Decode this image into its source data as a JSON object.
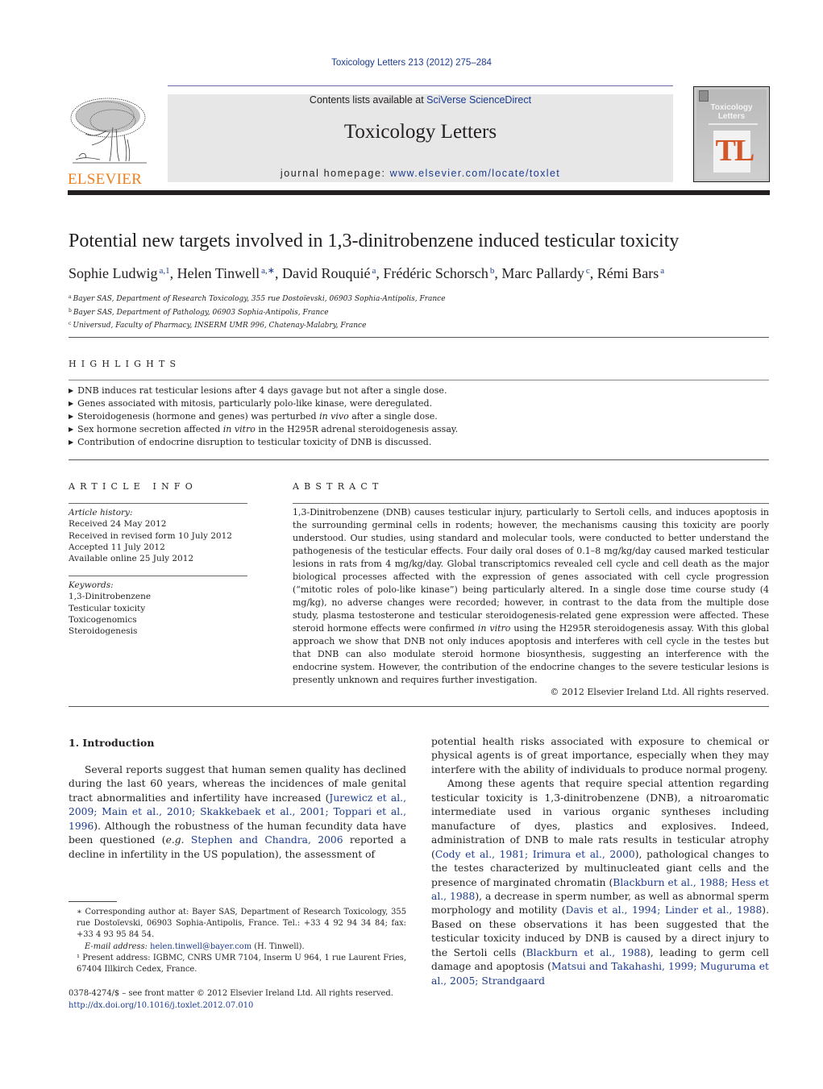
{
  "header": {
    "citation": "Toxicology Letters 213 (2012) 275–284",
    "contents_prefix": "Contents lists available at ",
    "contents_link": "SciVerse ScienceDirect",
    "journal_title": "Toxicology Letters",
    "homepage_prefix": "journal homepage: ",
    "homepage_link": "www.elsevier.com/locate/toxlet",
    "publisher_logo_text": "ELSEVIER",
    "cover": {
      "title_line1": "Toxicology",
      "title_line2": "Letters",
      "monogram": "TL"
    },
    "colors": {
      "link": "#1b3b8f",
      "elsevier_orange": "#f07f1e",
      "cover_accent": "#d4572a",
      "band": "#e7e7e7"
    }
  },
  "article": {
    "title": "Potential new targets involved in 1,3-dinitrobenzene induced testicular toxicity",
    "authors": [
      {
        "name": "Sophie Ludwig",
        "sup": "a,1",
        "sep": ", "
      },
      {
        "name": "Helen Tinwell",
        "sup": "a,∗",
        "sep": ", "
      },
      {
        "name": "David Rouquié",
        "sup": "a",
        "sep": ", "
      },
      {
        "name": "Frédéric Schorsch",
        "sup": "b",
        "sep": ", "
      },
      {
        "name": "Marc Pallardy",
        "sup": "c",
        "sep": ", "
      },
      {
        "name": "Rémi Bars",
        "sup": "a",
        "sep": ""
      }
    ],
    "affiliations": [
      {
        "key": "a",
        "text": "Bayer SAS, Department of Research Toxicology, 355 rue Dostoïevski, 06903 Sophia-Antipolis, France"
      },
      {
        "key": "b",
        "text": "Bayer SAS, Department of Pathology, 06903 Sophia-Antipolis, France"
      },
      {
        "key": "c",
        "text": "Universud, Faculty of Pharmacy, INSERM UMR 996, Chatenay-Malabry, France"
      }
    ]
  },
  "highlights": {
    "heading": "HIGHLIGHTS",
    "items": [
      {
        "before": "DNB induces rat testicular lesions after 4 days gavage but not after a single dose.",
        "em": "",
        "after": ""
      },
      {
        "before": "Genes associated with mitosis, particularly polo-like kinase, were deregulated.",
        "em": "",
        "after": ""
      },
      {
        "before": "Steroidogenesis (hormone and genes) was perturbed ",
        "em": "in vivo",
        "after": " after a single dose."
      },
      {
        "before": "Sex hormone secretion affected ",
        "em": "in vitro",
        "after": " in the H295R adrenal steroidogenesis assay."
      },
      {
        "before": "Contribution of endocrine disruption to testicular toxicity of DNB is discussed.",
        "em": "",
        "after": ""
      }
    ]
  },
  "article_info": {
    "heading": "ARTICLE INFO",
    "history_label": "Article history:",
    "history": [
      "Received 24 May 2012",
      "Received in revised form 10 July 2012",
      "Accepted 11 July 2012",
      "Available online 25 July 2012"
    ],
    "keywords_label": "Keywords:",
    "keywords": [
      "1,3-Dinitrobenzene",
      "Testicular toxicity",
      "Toxicogenomics",
      "Steroidogenesis"
    ]
  },
  "abstract": {
    "heading": "ABSTRACT",
    "part1": "1,3-Dinitrobenzene (DNB) causes testicular injury, particularly to Sertoli cells, and induces apoptosis in the surrounding germinal cells in rodents; however, the mechanisms causing this toxicity are poorly understood. Our studies, using standard and molecular tools, were conducted to better understand the pathogenesis of the testicular effects. Four daily oral doses of 0.1–8 mg/kg/day caused marked testicular lesions in rats from 4 mg/kg/day. Global transcriptomics revealed cell cycle and cell death as the major biological processes affected with the expression of genes associated with cell cycle progression (“mitotic roles of polo-like kinase”) being particularly altered. In a single dose time course study (4 mg/kg), no adverse changes were recorded; however, in contrast to the data from the multiple dose study, plasma testosterone and testicular steroidogenesis-related gene expression were affected. These steroid hormone effects were confirmed ",
    "em": "in vitro",
    "part2": " using the H295R steroidogenesis assay. With this global approach we show that DNB not only induces apoptosis and interferes with cell cycle in the testes but that DNB can also modulate steroid hormone biosynthesis, suggesting an interference with the endocrine system. However, the contribution of the endocrine changes to the severe testicular lesions is presently unknown and requires further investigation.",
    "copyright": "© 2012 Elsevier Ireland Ltd. All rights reserved."
  },
  "introduction": {
    "heading": "1.  Introduction",
    "p1_a": "Several reports suggest that human semen quality has declined during the last 60 years, whereas the incidences of male genital tract abnormalities and infertility have increased (",
    "p1_ref1": "Jurewicz et al., 2009; Main et al., 2010; Skakkebaek et al., 2001; Toppari et al., 1996",
    "p1_b": "). Although the robustness of the human fecundity data have been questioned (",
    "p1_eg": "e.g.",
    "p1_c": " ",
    "p1_ref2": "Stephen and Chandra, 2006",
    "p1_d": " reported a decline in infertility in the US population), the assessment of potential health risks associated with exposure to chemical or physical agents is of great importance, especially when they may interfere with the ability of individuals to produce normal progeny.",
    "p2_a": "Among these agents that require special attention regarding testicular toxicity is 1,3-dinitrobenzene (DNB), a nitroaromatic intermediate used in various organic syntheses including manufacture of dyes, plastics and explosives. Indeed, administration of DNB to male rats results in testicular atrophy (",
    "p2_ref1": "Cody et al., 1981; Irimura et al., 2000",
    "p2_b": "), pathological changes to the testes characterized by multinucleated giant cells and the presence of marginated chromatin (",
    "p2_ref2": "Blackburn et al., 1988; Hess et al., 1988",
    "p2_c": "), a decrease in sperm number, as well as abnormal sperm morphology and motility (",
    "p2_ref3": "Davis et al., 1994; Linder et al., 1988",
    "p2_d": "). Based on these observations it has been suggested that the testicular toxicity induced by DNB is caused by a direct injury to the Sertoli cells (",
    "p2_ref4": "Blackburn et al., 1988",
    "p2_e": "), leading to germ cell damage and apoptosis (",
    "p2_ref5": "Matsui and Takahashi, 1999; Muguruma et al., 2005; Strandgaard"
  },
  "footnotes": {
    "corresponding": "∗ Corresponding author at: Bayer SAS, Department of Research Toxicology, 355 rue Dostoïevski, 06903 Sophia-Antipolis, France. Tel.: +33 4 92 94 34 84; fax: +33 4 93 95 84 54.",
    "email_label": "E-mail address:",
    "email": "helen.tinwell@bayer.com",
    "email_suffix": " (H. Tinwell).",
    "present_address": "¹ Present address: IGBMC, CNRS UMR 7104, Inserm U 964, 1 rue Laurent Fries, 67404 Illkirch Cedex, France.",
    "front_matter": "0378-4274/$ – see front matter © 2012 Elsevier Ireland Ltd. All rights reserved.",
    "doi": "http://dx.doi.org/10.1016/j.toxlet.2012.07.010"
  }
}
